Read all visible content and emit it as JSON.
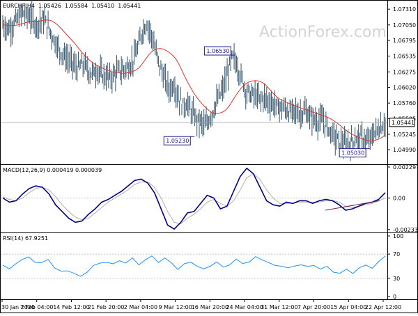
{
  "chart_data": [
    {
      "type": "candlestick",
      "panel": "price",
      "symbol": "EURCHF,H4",
      "ohlc_header": {
        "open": "1.05426",
        "high": "1.05584",
        "low": "1.05410",
        "close": "1.05441"
      },
      "ylim": [
        1.0475,
        1.0745
      ],
      "y_ticks": [
        "1.07310",
        "1.07050",
        "1.06795",
        "1.06535",
        "1.06275",
        "1.06020",
        "1.05760",
        "1.05505",
        "1.05245",
        "1.04990"
      ],
      "current_price": "1.05441",
      "moving_average": "red",
      "annotations": [
        {
          "label": "1.06530",
          "value": 1.0653,
          "x": "23 Mar 2020"
        },
        {
          "label": "1.05230",
          "value": 1.0523,
          "x": "9 Mar 2020"
        },
        {
          "label": "1.05030",
          "value": 1.0503,
          "x": "20 Apr 2020"
        }
      ],
      "path": [
        [
          0,
          1.0705
        ],
        [
          3,
          1.0698
        ],
        [
          6,
          1.0712
        ],
        [
          9,
          1.0725
        ],
        [
          12,
          1.0718
        ],
        [
          15,
          1.0705
        ],
        [
          18,
          1.0715
        ],
        [
          21,
          1.0695
        ],
        [
          24,
          1.0672
        ],
        [
          27,
          1.0655
        ],
        [
          30,
          1.0645
        ],
        [
          33,
          1.0633
        ],
        [
          36,
          1.064
        ],
        [
          39,
          1.0625
        ],
        [
          42,
          1.063
        ],
        [
          45,
          1.062
        ],
        [
          48,
          1.0618
        ],
        [
          51,
          1.0628
        ],
        [
          54,
          1.0632
        ],
        [
          57,
          1.064
        ],
        [
          60,
          1.0665
        ],
        [
          62,
          1.0695
        ],
        [
          64,
          1.0708
        ],
        [
          66,
          1.069
        ],
        [
          68,
          1.066
        ],
        [
          70,
          1.0635
        ],
        [
          72,
          1.0615
        ],
        [
          74,
          1.0598
        ],
        [
          76,
          1.0608
        ],
        [
          78,
          1.0585
        ],
        [
          80,
          1.0572
        ],
        [
          82,
          1.0575
        ],
        [
          84,
          1.056
        ],
        [
          86,
          1.055
        ],
        [
          88,
          1.0545
        ],
        [
          90,
          1.0537
        ],
        [
          92,
          1.0552
        ],
        [
          94,
          1.0568
        ],
        [
          96,
          1.0585
        ],
        [
          98,
          1.06
        ],
        [
          100,
          1.0625
        ],
        [
          102,
          1.0653
        ],
        [
          104,
          1.064
        ],
        [
          106,
          1.0618
        ],
        [
          108,
          1.0598
        ],
        [
          110,
          1.059
        ],
        [
          112,
          1.0588
        ],
        [
          114,
          1.0582
        ],
        [
          116,
          1.0585
        ],
        [
          118,
          1.0579
        ],
        [
          120,
          1.0575
        ],
        [
          122,
          1.057
        ],
        [
          124,
          1.0568
        ],
        [
          126,
          1.0565
        ],
        [
          128,
          1.056
        ],
        [
          130,
          1.0563
        ],
        [
          132,
          1.0558
        ],
        [
          134,
          1.0562
        ],
        [
          136,
          1.0555
        ],
        [
          138,
          1.055
        ],
        [
          140,
          1.0545
        ],
        [
          142,
          1.0548
        ],
        [
          144,
          1.0538
        ],
        [
          146,
          1.0528
        ],
        [
          148,
          1.0518
        ],
        [
          150,
          1.0512
        ],
        [
          152,
          1.0506
        ],
        [
          154,
          1.0509
        ],
        [
          156,
          1.0514
        ],
        [
          158,
          1.052
        ],
        [
          160,
          1.0516
        ],
        [
          162,
          1.051
        ],
        [
          164,
          1.0521
        ],
        [
          166,
          1.053
        ],
        [
          168,
          1.0536
        ],
        [
          170,
          1.0544
        ]
      ],
      "x_labels": [
        "30 Jan 2020",
        "7 Feb 04:00",
        "14 Feb 12:00",
        "21 Feb 20:00",
        "2 Mar 04:00",
        "9 Mar 12:00",
        "16 Mar 20:00",
        "24 Mar 04:00",
        "31 Mar 12:00",
        "7 Apr 20:00",
        "15 Apr 04:00",
        "22 Apr 12:00"
      ]
    },
    {
      "type": "line",
      "panel": "macd",
      "title": "MACD(12,26,9) 0.000419 0.000039",
      "ylim": [
        -0.00255,
        0.00245
      ],
      "y_ticks": [
        "0.002297",
        "0.00",
        "-0.002336"
      ],
      "series": [
        {
          "color": "#00008b",
          "values": [
            0.0,
            -0.0003,
            -0.0002,
            0.0003,
            0.0007,
            0.0009,
            0.0008,
            0.0003,
            -0.0005,
            -0.001,
            -0.0015,
            -0.0018,
            -0.0017,
            -0.0012,
            -0.0008,
            -0.0003,
            -0.0001,
            0.0002,
            0.0005,
            0.0009,
            0.0013,
            0.0014,
            0.0011,
            0.0004,
            -0.0008,
            -0.002,
            -0.0023,
            -0.0018,
            -0.0011,
            -0.001,
            -0.0004,
            0.0002,
            0.0,
            -0.0008,
            -0.0006,
            0.0005,
            0.0016,
            0.0022,
            0.0018,
            0.0008,
            -0.0002,
            -0.0005,
            -0.0006,
            -0.0003,
            -0.0004,
            -0.0002,
            -0.0002,
            -0.0004,
            -0.0002,
            -0.0001,
            -0.0002,
            -0.0005,
            -0.0009,
            -0.0008,
            -0.0006,
            -0.0004,
            -0.0003,
            -0.0001,
            0.0004
          ]
        },
        {
          "color": "#b0b0b0",
          "values": [
            0.0001,
            -0.0001,
            -0.0002,
            0.0,
            0.0004,
            0.0007,
            0.0008,
            0.0006,
            0.0001,
            -0.0005,
            -0.001,
            -0.0014,
            -0.0016,
            -0.0015,
            -0.0011,
            -0.0007,
            -0.0003,
            0.0,
            0.0003,
            0.0006,
            0.001,
            0.0012,
            0.0012,
            0.0008,
            0.0,
            -0.001,
            -0.0018,
            -0.0019,
            -0.0015,
            -0.0012,
            -0.0008,
            -0.0003,
            -0.0001,
            -0.0004,
            -0.0006,
            -0.0002,
            0.0006,
            0.0015,
            0.0018,
            0.0014,
            0.0006,
            0.0,
            -0.0004,
            -0.0004,
            -0.0004,
            -0.0003,
            -0.0003,
            -0.0003,
            -0.0003,
            -0.0002,
            -0.0002,
            -0.0003,
            -0.0006,
            -0.0007,
            -0.0006,
            -0.0005,
            -0.0004,
            -0.0002,
            0.0
          ]
        }
      ],
      "trendline": {
        "from": [
          0.84,
          -0.0009
        ],
        "to": [
          0.98,
          -0.0002
        ]
      }
    },
    {
      "type": "line",
      "panel": "rsi",
      "title": "RSI(14) 67.9251",
      "ylim": [
        0,
        100
      ],
      "y_ticks": [
        "100",
        "70",
        "30",
        "0"
      ],
      "levels": [
        70,
        30
      ],
      "series": [
        {
          "color": "#1e90ff",
          "values": [
            52,
            44,
            56,
            60,
            65,
            58,
            54,
            62,
            48,
            40,
            44,
            38,
            32,
            42,
            50,
            55,
            58,
            52,
            60,
            56,
            62,
            54,
            60,
            66,
            58,
            62,
            56,
            46,
            52,
            58,
            50,
            44,
            52,
            56,
            48,
            54,
            60,
            55,
            58,
            64,
            62,
            56,
            50,
            52,
            46,
            50,
            54,
            48,
            52,
            46,
            48,
            42,
            38,
            44,
            40,
            46,
            52,
            48,
            56,
            68
          ]
        }
      ]
    }
  ],
  "watermark": "ActionForex.com"
}
